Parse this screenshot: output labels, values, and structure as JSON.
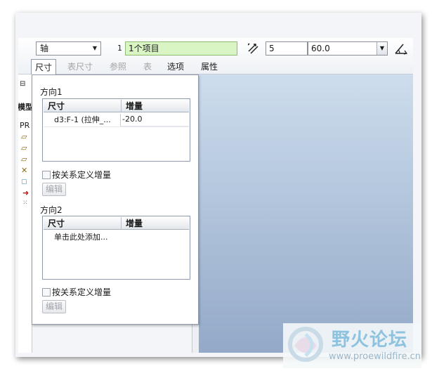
{
  "toolbar": {
    "axis_select": "轴",
    "collector_count": "1",
    "collector_value": "1个项目",
    "value_input": "5",
    "combo_value": "60.0"
  },
  "tabs": [
    {
      "label": "尺寸",
      "state": "active"
    },
    {
      "label": "表尺寸",
      "state": "disabled"
    },
    {
      "label": "参照",
      "state": "disabled"
    },
    {
      "label": "表",
      "state": "disabled"
    },
    {
      "label": "选项",
      "state": "enabled"
    },
    {
      "label": "属性",
      "state": "enabled"
    }
  ],
  "tree": {
    "header_fragment": "模型",
    "root_fragment": "PR"
  },
  "panel": {
    "direction1": {
      "label": "方向1",
      "col_dim": "尺寸",
      "col_inc": "增量",
      "rows": [
        {
          "dim": "d3:F-1 (拉伸_...",
          "inc": "-20.0"
        }
      ],
      "relation_checkbox": "按关系定义增量",
      "edit_button": "编辑"
    },
    "direction2": {
      "label": "方向2",
      "col_dim": "尺寸",
      "col_inc": "增量",
      "placeholder_row": "单击此处添加...",
      "relation_checkbox": "按关系定义增量",
      "edit_button": "编辑"
    }
  },
  "watermark": {
    "title": "野火论坛",
    "url": "www.proewildfire.cn"
  },
  "colors": {
    "collector_bg": "#d9f5c4",
    "graphics_top": "#cddded",
    "graphics_bottom": "#93a9c8"
  }
}
